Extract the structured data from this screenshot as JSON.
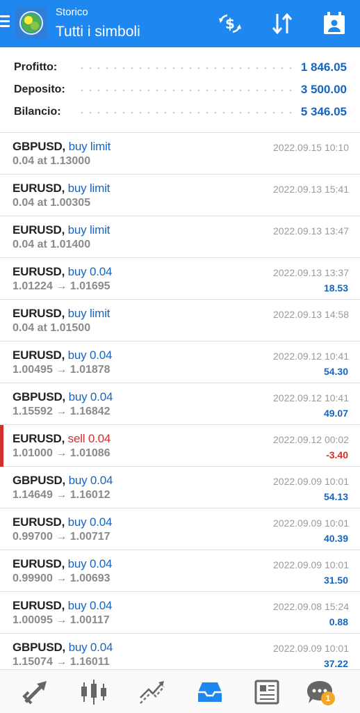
{
  "header": {
    "subtitle": "Storico",
    "title": "Tutti i simboli"
  },
  "summary": [
    {
      "label": "Profitto:",
      "value": "1 846.05"
    },
    {
      "label": "Deposito:",
      "value": "3 500.00"
    },
    {
      "label": "Bilancio:",
      "value": "5 346.05"
    }
  ],
  "colors": {
    "header_bg": "#1e88f0",
    "buy": "#1565c0",
    "sell": "#d32f2f",
    "value_blue": "#1565c0"
  },
  "trades": [
    {
      "symbol": "GBPUSD,",
      "action": "buy limit",
      "side": "buy",
      "detail": "0.04 at 1.13000",
      "time": "2022.09.15 10:10",
      "profit": ""
    },
    {
      "symbol": "EURUSD,",
      "action": "buy limit",
      "side": "buy",
      "detail": "0.04 at 1.00305",
      "time": "2022.09.13 15:41",
      "profit": ""
    },
    {
      "symbol": "EURUSD,",
      "action": "buy limit",
      "side": "buy",
      "detail": "0.04 at 1.01400",
      "time": "2022.09.13 13:47",
      "profit": ""
    },
    {
      "symbol": "EURUSD,",
      "action": "buy 0.04",
      "side": "buy",
      "detail": "1.01224 → 1.01695",
      "time": "2022.09.13 13:37",
      "profit": "18.53"
    },
    {
      "symbol": "EURUSD,",
      "action": "buy limit",
      "side": "buy",
      "detail": "0.04 at 1.01500",
      "time": "2022.09.13 14:58",
      "profit": ""
    },
    {
      "symbol": "EURUSD,",
      "action": "buy 0.04",
      "side": "buy",
      "detail": "1.00495 → 1.01878",
      "time": "2022.09.12 10:41",
      "profit": "54.30"
    },
    {
      "symbol": "GBPUSD,",
      "action": "buy 0.04",
      "side": "buy",
      "detail": "1.15592 → 1.16842",
      "time": "2022.09.12 10:41",
      "profit": "49.07"
    },
    {
      "symbol": "EURUSD,",
      "action": "sell 0.04",
      "side": "sell",
      "detail": "1.01000 → 1.01086",
      "time": "2022.09.12 00:02",
      "profit": "-3.40"
    },
    {
      "symbol": "GBPUSD,",
      "action": "buy 0.04",
      "side": "buy",
      "detail": "1.14649 → 1.16012",
      "time": "2022.09.09 10:01",
      "profit": "54.13"
    },
    {
      "symbol": "EURUSD,",
      "action": "buy 0.04",
      "side": "buy",
      "detail": "0.99700 → 1.00717",
      "time": "2022.09.09 10:01",
      "profit": "40.39"
    },
    {
      "symbol": "EURUSD,",
      "action": "buy 0.04",
      "side": "buy",
      "detail": "0.99900 → 1.00693",
      "time": "2022.09.09 10:01",
      "profit": "31.50"
    },
    {
      "symbol": "EURUSD,",
      "action": "buy 0.04",
      "side": "buy",
      "detail": "1.00095 → 1.00117",
      "time": "2022.09.08 15:24",
      "profit": "0.88"
    },
    {
      "symbol": "GBPUSD,",
      "action": "buy 0.04",
      "side": "buy",
      "detail": "1.15074 → 1.16011",
      "time": "2022.09.09 10:01",
      "profit": "37.22"
    }
  ],
  "bottom_nav": {
    "items": [
      {
        "icon": "quotes-icon"
      },
      {
        "icon": "chart-icon"
      },
      {
        "icon": "trade-icon"
      },
      {
        "icon": "history-icon",
        "active": true
      },
      {
        "icon": "news-icon"
      },
      {
        "icon": "chat-icon"
      }
    ],
    "chat_badge": "1"
  }
}
